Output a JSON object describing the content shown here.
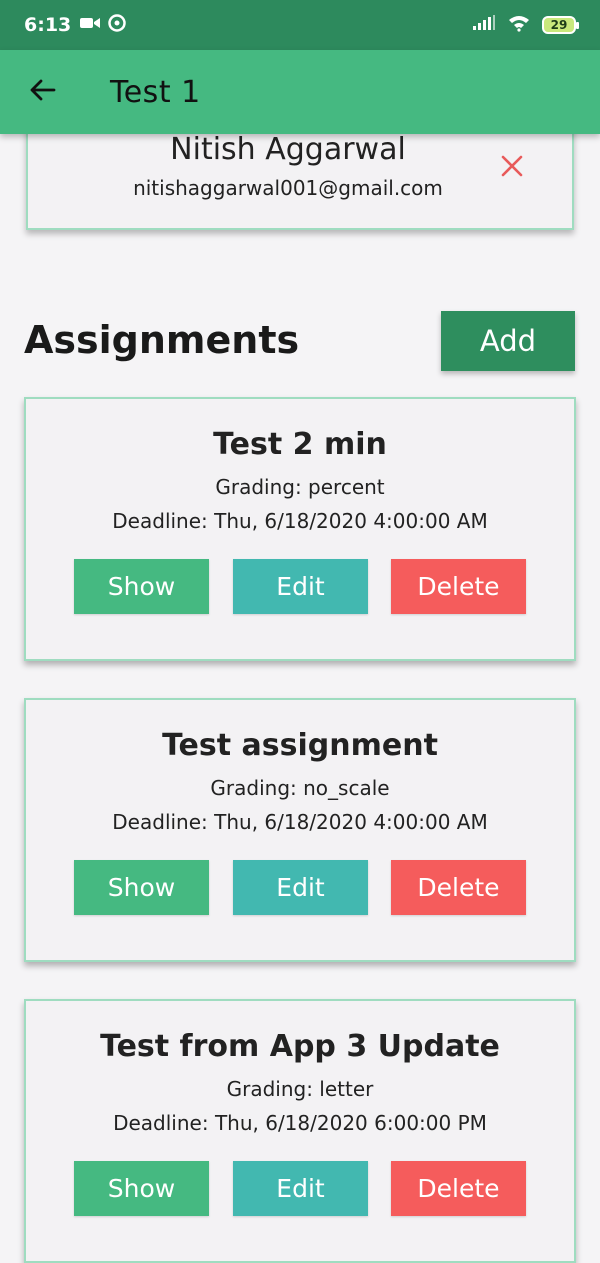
{
  "status_bar": {
    "time": "6:13",
    "battery": "29",
    "icons": [
      "video-icon",
      "data-saver-icon",
      "signal-icon",
      "wifi-icon"
    ]
  },
  "app_bar": {
    "title": "Test  1",
    "back_icon": "arrow-left-icon",
    "color": "#45b981"
  },
  "user": {
    "name": "Nitish Aggarwal",
    "email": "nitishaggarwal001@gmail.com",
    "remove_icon": "close-icon",
    "remove_color": "#e85a5a"
  },
  "assignments": {
    "heading": "Assignments",
    "add_label": "Add",
    "items": [
      {
        "title": "Test 2 min",
        "grading": "Grading: percent",
        "deadline": "Deadline: Thu, 6/18/2020 4:00:00 AM",
        "show_label": "Show",
        "edit_label": "Edit",
        "delete_label": "Delete"
      },
      {
        "title": "Test assignment",
        "grading": "Grading: no_scale",
        "deadline": "Deadline: Thu, 6/18/2020 4:00:00 AM",
        "show_label": "Show",
        "edit_label": "Edit",
        "delete_label": "Delete"
      },
      {
        "title": "Test from App 3 Update",
        "grading": "Grading: letter",
        "deadline": "Deadline: Thu, 6/18/2020 6:00:00 PM",
        "show_label": "Show",
        "edit_label": "Edit",
        "delete_label": "Delete"
      }
    ]
  },
  "colors": {
    "show": "#45b981",
    "edit": "#42b8b0",
    "delete": "#f55c5c",
    "add": "#2e8e5e"
  }
}
